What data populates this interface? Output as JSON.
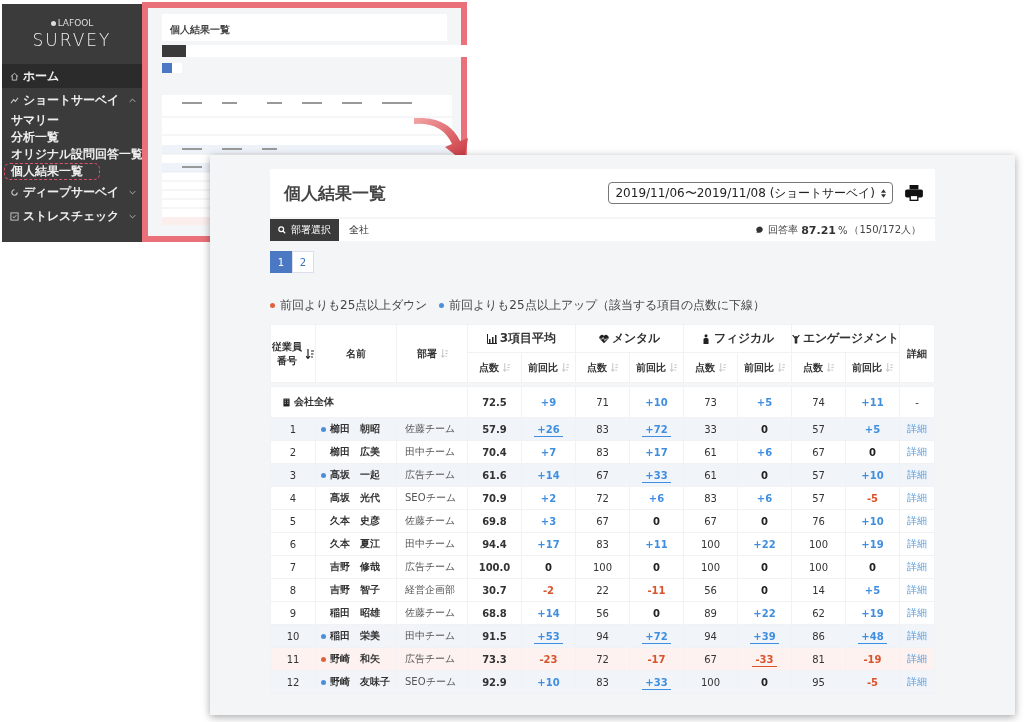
{
  "sidebar": {
    "brand": "LAFOOL",
    "title": "SURVEY",
    "items": [
      {
        "label": "ホーム",
        "selected": true
      },
      {
        "label": "ショートサーベイ",
        "selected": false,
        "expanded": true,
        "children": [
          {
            "label": "サマリー",
            "highlighted": false
          },
          {
            "label": "分析一覧",
            "highlighted": false
          },
          {
            "label": "オリジナル設問回答一覧",
            "highlighted": false
          },
          {
            "label": "個人結果一覧",
            "highlighted": true
          }
        ]
      },
      {
        "label": "ディープサーベイ",
        "selected": false,
        "expanded": false
      },
      {
        "label": "ストレスチェック",
        "selected": false,
        "expanded": false
      }
    ]
  },
  "thumbnail": {
    "title": "個人結果一覧"
  },
  "page": {
    "title": "個人結果一覧",
    "period": "2019/11/06〜2019/11/08 (ショートサーベイ)",
    "filter": {
      "button": "部署選択",
      "value": "全社"
    },
    "response": {
      "label": "回答率",
      "value": "87.21",
      "unit": "%",
      "count": "（150/172人）"
    },
    "pages": [
      {
        "label": "1",
        "selected": true
      },
      {
        "label": "2",
        "selected": false
      }
    ],
    "legend": [
      {
        "text": "前回よりも25点以上ダウン",
        "color": "#e0633f"
      },
      {
        "text": "前回よりも25点以上アップ（該当する項目の点数に下線）",
        "color": "#4a90d9"
      }
    ]
  },
  "table": {
    "id_header": "従業員番号",
    "name_header": "名前",
    "dept_header": "部署",
    "detail_header": "詳細",
    "groups": [
      {
        "label": "3項目平均",
        "sub": [
          "点数",
          "前回比"
        ]
      },
      {
        "label": "メンタル",
        "sub": [
          "点数",
          "前回比"
        ]
      },
      {
        "label": "フィジカル",
        "sub": [
          "点数",
          "前回比"
        ]
      },
      {
        "label": "エンゲージメント",
        "sub": [
          "点数",
          "前回比"
        ]
      }
    ],
    "total": {
      "label": "会社全体",
      "cells": [
        "72.5",
        "+9",
        "71",
        "+10",
        "73",
        "+5",
        "74",
        "+11"
      ],
      "detail": "-"
    },
    "rows": [
      {
        "no": "1",
        "name": "櫛田　朝昭",
        "dept": "佐藤チーム",
        "kind": "up",
        "scores": [
          "57.9",
          "83",
          "33",
          "57"
        ],
        "diffs": [
          {
            "v": "+26",
            "kind": "up",
            "underline": true
          },
          {
            "v": "+72",
            "kind": "up",
            "underline": true
          },
          {
            "v": "0",
            "kind": "flat",
            "underline": false
          },
          {
            "v": "+5",
            "kind": "up",
            "underline": false
          }
        ],
        "detail": "詳細"
      },
      {
        "no": "2",
        "name": "櫛田　広美",
        "dept": "田中チーム",
        "kind": "none",
        "scores": [
          "70.4",
          "83",
          "61",
          "67"
        ],
        "diffs": [
          {
            "v": "+7",
            "kind": "up",
            "underline": false
          },
          {
            "v": "+17",
            "kind": "up",
            "underline": false
          },
          {
            "v": "+6",
            "kind": "up",
            "underline": false
          },
          {
            "v": "0",
            "kind": "flat",
            "underline": false
          }
        ],
        "detail": "詳細"
      },
      {
        "no": "3",
        "name": "髙坂　一起",
        "dept": "広告チーム",
        "kind": "up",
        "scores": [
          "61.6",
          "67",
          "61",
          "57"
        ],
        "diffs": [
          {
            "v": "+14",
            "kind": "up",
            "underline": false
          },
          {
            "v": "+33",
            "kind": "up",
            "underline": true
          },
          {
            "v": "0",
            "kind": "flat",
            "underline": false
          },
          {
            "v": "+10",
            "kind": "up",
            "underline": false
          }
        ],
        "detail": "詳細"
      },
      {
        "no": "4",
        "name": "髙坂　光代",
        "dept": "SEOチーム",
        "kind": "none",
        "scores": [
          "70.9",
          "72",
          "83",
          "57"
        ],
        "diffs": [
          {
            "v": "+2",
            "kind": "up",
            "underline": false
          },
          {
            "v": "+6",
            "kind": "up",
            "underline": false
          },
          {
            "v": "+6",
            "kind": "up",
            "underline": false
          },
          {
            "v": "-5",
            "kind": "down",
            "underline": false
          }
        ],
        "detail": "詳細"
      },
      {
        "no": "5",
        "name": "久本　史彦",
        "dept": "佐藤チーム",
        "kind": "none",
        "scores": [
          "69.8",
          "67",
          "67",
          "76"
        ],
        "diffs": [
          {
            "v": "+3",
            "kind": "up",
            "underline": false
          },
          {
            "v": "0",
            "kind": "flat",
            "underline": false
          },
          {
            "v": "0",
            "kind": "flat",
            "underline": false
          },
          {
            "v": "+10",
            "kind": "up",
            "underline": false
          }
        ],
        "detail": "詳細"
      },
      {
        "no": "6",
        "name": "久本　夏江",
        "dept": "田中チーム",
        "kind": "none",
        "scores": [
          "94.4",
          "83",
          "100",
          "100"
        ],
        "diffs": [
          {
            "v": "+17",
            "kind": "up",
            "underline": false
          },
          {
            "v": "+11",
            "kind": "up",
            "underline": false
          },
          {
            "v": "+22",
            "kind": "up",
            "underline": false
          },
          {
            "v": "+19",
            "kind": "up",
            "underline": false
          }
        ],
        "detail": "詳細"
      },
      {
        "no": "7",
        "name": "吉野　修哉",
        "dept": "広告チーム",
        "kind": "none",
        "scores": [
          "100.0",
          "100",
          "100",
          "100"
        ],
        "diffs": [
          {
            "v": "0",
            "kind": "flat",
            "underline": false
          },
          {
            "v": "0",
            "kind": "flat",
            "underline": false
          },
          {
            "v": "0",
            "kind": "flat",
            "underline": false
          },
          {
            "v": "0",
            "kind": "flat",
            "underline": false
          }
        ],
        "detail": "詳細"
      },
      {
        "no": "8",
        "name": "吉野　智子",
        "dept": "経営企画部",
        "kind": "none",
        "scores": [
          "30.7",
          "22",
          "56",
          "14"
        ],
        "diffs": [
          {
            "v": "-2",
            "kind": "down",
            "underline": false
          },
          {
            "v": "-11",
            "kind": "down",
            "underline": false
          },
          {
            "v": "0",
            "kind": "flat",
            "underline": false
          },
          {
            "v": "+5",
            "kind": "up",
            "underline": false
          }
        ],
        "detail": "詳細"
      },
      {
        "no": "9",
        "name": "稲田　昭雄",
        "dept": "佐藤チーム",
        "kind": "none",
        "scores": [
          "68.8",
          "56",
          "89",
          "62"
        ],
        "diffs": [
          {
            "v": "+14",
            "kind": "up",
            "underline": false
          },
          {
            "v": "0",
            "kind": "flat",
            "underline": false
          },
          {
            "v": "+22",
            "kind": "up",
            "underline": false
          },
          {
            "v": "+19",
            "kind": "up",
            "underline": false
          }
        ],
        "detail": "詳細"
      },
      {
        "no": "10",
        "name": "稲田　栄美",
        "dept": "田中チーム",
        "kind": "up",
        "scores": [
          "91.5",
          "94",
          "94",
          "86"
        ],
        "diffs": [
          {
            "v": "+53",
            "kind": "up",
            "underline": true
          },
          {
            "v": "+72",
            "kind": "up",
            "underline": true
          },
          {
            "v": "+39",
            "kind": "up",
            "underline": true
          },
          {
            "v": "+48",
            "kind": "up",
            "underline": true
          }
        ],
        "detail": "詳細"
      },
      {
        "no": "11",
        "name": "野崎　和矢",
        "dept": "広告チーム",
        "kind": "down",
        "scores": [
          "73.3",
          "72",
          "67",
          "81"
        ],
        "diffs": [
          {
            "v": "-23",
            "kind": "down",
            "underline": false
          },
          {
            "v": "-17",
            "kind": "down",
            "underline": false
          },
          {
            "v": "-33",
            "kind": "down",
            "underline": true
          },
          {
            "v": "-19",
            "kind": "down",
            "underline": false
          }
        ],
        "detail": "詳細"
      },
      {
        "no": "12",
        "name": "野崎　友味子",
        "dept": "SEOチーム",
        "kind": "up",
        "scores": [
          "92.9",
          "83",
          "100",
          "95"
        ],
        "diffs": [
          {
            "v": "+10",
            "kind": "up",
            "underline": false
          },
          {
            "v": "+33",
            "kind": "up",
            "underline": true
          },
          {
            "v": "0",
            "kind": "flat",
            "underline": false
          },
          {
            "v": "-5",
            "kind": "down",
            "underline": false
          }
        ],
        "detail": "詳細"
      }
    ]
  }
}
